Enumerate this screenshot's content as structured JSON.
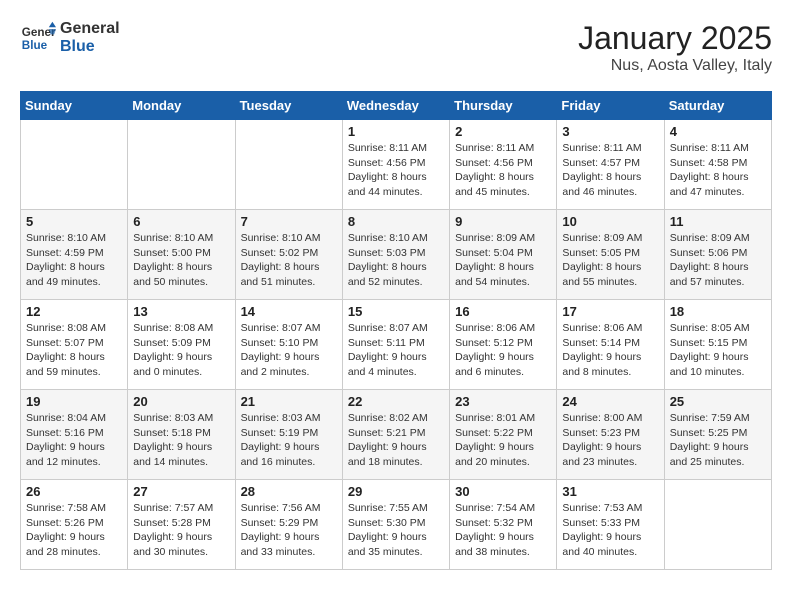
{
  "logo": {
    "general": "General",
    "blue": "Blue"
  },
  "title": "January 2025",
  "subtitle": "Nus, Aosta Valley, Italy",
  "weekdays": [
    "Sunday",
    "Monday",
    "Tuesday",
    "Wednesday",
    "Thursday",
    "Friday",
    "Saturday"
  ],
  "weeks": [
    [
      {
        "day": null
      },
      {
        "day": null
      },
      {
        "day": null
      },
      {
        "day": "1",
        "sunrise": "8:11 AM",
        "sunset": "4:56 PM",
        "daylight": "8 hours and 44 minutes."
      },
      {
        "day": "2",
        "sunrise": "8:11 AM",
        "sunset": "4:56 PM",
        "daylight": "8 hours and 45 minutes."
      },
      {
        "day": "3",
        "sunrise": "8:11 AM",
        "sunset": "4:57 PM",
        "daylight": "8 hours and 46 minutes."
      },
      {
        "day": "4",
        "sunrise": "8:11 AM",
        "sunset": "4:58 PM",
        "daylight": "8 hours and 47 minutes."
      }
    ],
    [
      {
        "day": "5",
        "sunrise": "8:10 AM",
        "sunset": "4:59 PM",
        "daylight": "8 hours and 49 minutes."
      },
      {
        "day": "6",
        "sunrise": "8:10 AM",
        "sunset": "5:00 PM",
        "daylight": "8 hours and 50 minutes."
      },
      {
        "day": "7",
        "sunrise": "8:10 AM",
        "sunset": "5:02 PM",
        "daylight": "8 hours and 51 minutes."
      },
      {
        "day": "8",
        "sunrise": "8:10 AM",
        "sunset": "5:03 PM",
        "daylight": "8 hours and 52 minutes."
      },
      {
        "day": "9",
        "sunrise": "8:09 AM",
        "sunset": "5:04 PM",
        "daylight": "8 hours and 54 minutes."
      },
      {
        "day": "10",
        "sunrise": "8:09 AM",
        "sunset": "5:05 PM",
        "daylight": "8 hours and 55 minutes."
      },
      {
        "day": "11",
        "sunrise": "8:09 AM",
        "sunset": "5:06 PM",
        "daylight": "8 hours and 57 minutes."
      }
    ],
    [
      {
        "day": "12",
        "sunrise": "8:08 AM",
        "sunset": "5:07 PM",
        "daylight": "8 hours and 59 minutes."
      },
      {
        "day": "13",
        "sunrise": "8:08 AM",
        "sunset": "5:09 PM",
        "daylight": "9 hours and 0 minutes."
      },
      {
        "day": "14",
        "sunrise": "8:07 AM",
        "sunset": "5:10 PM",
        "daylight": "9 hours and 2 minutes."
      },
      {
        "day": "15",
        "sunrise": "8:07 AM",
        "sunset": "5:11 PM",
        "daylight": "9 hours and 4 minutes."
      },
      {
        "day": "16",
        "sunrise": "8:06 AM",
        "sunset": "5:12 PM",
        "daylight": "9 hours and 6 minutes."
      },
      {
        "day": "17",
        "sunrise": "8:06 AM",
        "sunset": "5:14 PM",
        "daylight": "9 hours and 8 minutes."
      },
      {
        "day": "18",
        "sunrise": "8:05 AM",
        "sunset": "5:15 PM",
        "daylight": "9 hours and 10 minutes."
      }
    ],
    [
      {
        "day": "19",
        "sunrise": "8:04 AM",
        "sunset": "5:16 PM",
        "daylight": "9 hours and 12 minutes."
      },
      {
        "day": "20",
        "sunrise": "8:03 AM",
        "sunset": "5:18 PM",
        "daylight": "9 hours and 14 minutes."
      },
      {
        "day": "21",
        "sunrise": "8:03 AM",
        "sunset": "5:19 PM",
        "daylight": "9 hours and 16 minutes."
      },
      {
        "day": "22",
        "sunrise": "8:02 AM",
        "sunset": "5:21 PM",
        "daylight": "9 hours and 18 minutes."
      },
      {
        "day": "23",
        "sunrise": "8:01 AM",
        "sunset": "5:22 PM",
        "daylight": "9 hours and 20 minutes."
      },
      {
        "day": "24",
        "sunrise": "8:00 AM",
        "sunset": "5:23 PM",
        "daylight": "9 hours and 23 minutes."
      },
      {
        "day": "25",
        "sunrise": "7:59 AM",
        "sunset": "5:25 PM",
        "daylight": "9 hours and 25 minutes."
      }
    ],
    [
      {
        "day": "26",
        "sunrise": "7:58 AM",
        "sunset": "5:26 PM",
        "daylight": "9 hours and 28 minutes."
      },
      {
        "day": "27",
        "sunrise": "7:57 AM",
        "sunset": "5:28 PM",
        "daylight": "9 hours and 30 minutes."
      },
      {
        "day": "28",
        "sunrise": "7:56 AM",
        "sunset": "5:29 PM",
        "daylight": "9 hours and 33 minutes."
      },
      {
        "day": "29",
        "sunrise": "7:55 AM",
        "sunset": "5:30 PM",
        "daylight": "9 hours and 35 minutes."
      },
      {
        "day": "30",
        "sunrise": "7:54 AM",
        "sunset": "5:32 PM",
        "daylight": "9 hours and 38 minutes."
      },
      {
        "day": "31",
        "sunrise": "7:53 AM",
        "sunset": "5:33 PM",
        "daylight": "9 hours and 40 minutes."
      },
      {
        "day": null
      }
    ]
  ]
}
